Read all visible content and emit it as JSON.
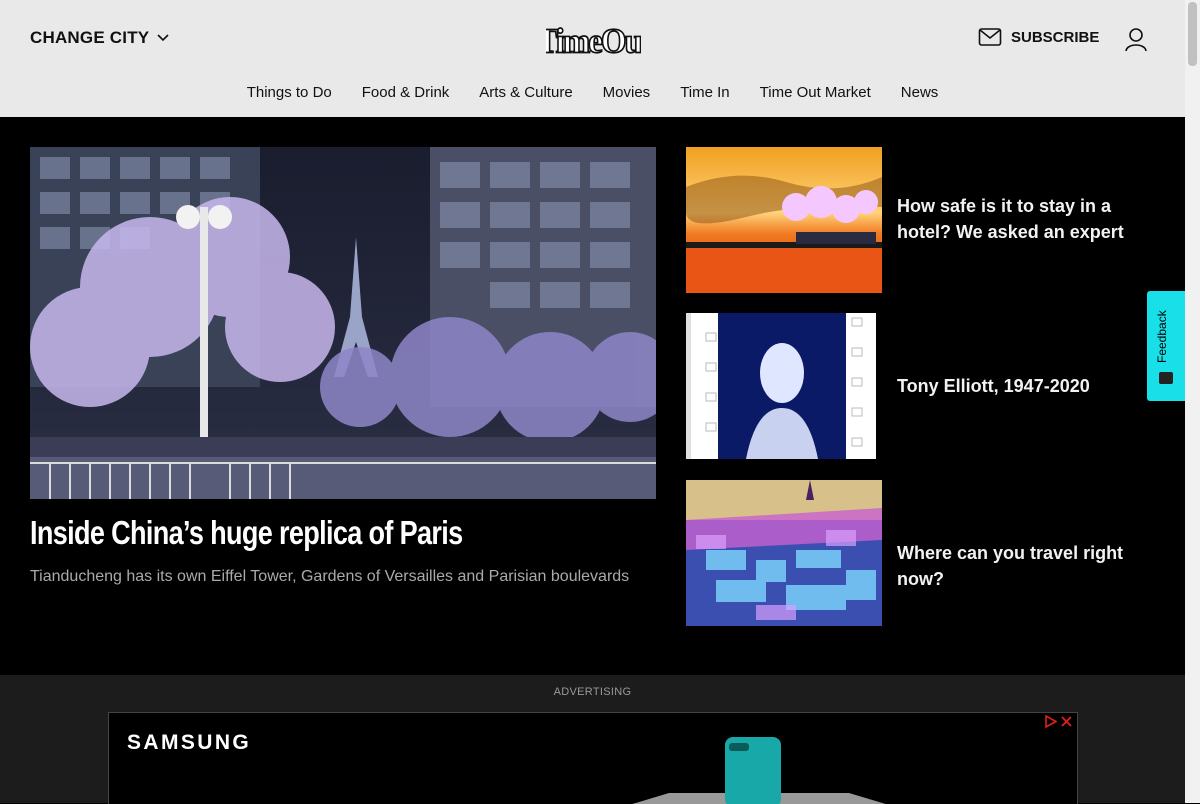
{
  "header": {
    "change_city": "CHANGE CITY",
    "logo_alt": "Time Out",
    "subscribe": "SUBSCRIBE"
  },
  "nav": [
    {
      "label": "Things to Do"
    },
    {
      "label": "Food & Drink"
    },
    {
      "label": "Arts & Culture"
    },
    {
      "label": "Movies"
    },
    {
      "label": "Time In"
    },
    {
      "label": "Time Out Market"
    },
    {
      "label": "News"
    }
  ],
  "hero": {
    "title": "Inside China’s huge replica of Paris",
    "subtitle": "Tianducheng has its own Eiffel Tower, Gardens of Versailles and Parisian boulevards"
  },
  "side_articles": [
    {
      "title": "How safe is it to stay in a hotel? We asked an expert"
    },
    {
      "title": "Tony Elliott, 1947-2020"
    },
    {
      "title": "Where can you travel right now?"
    }
  ],
  "feedback": {
    "label": "Feedback"
  },
  "ad": {
    "label": "ADVERTISING",
    "brand": "SAMSUNG"
  },
  "colors": {
    "header_bg": "#e9e9e9",
    "page_bg": "#000000",
    "feedback_bg": "#19e0e8",
    "ad_band_bg": "#1c1c1c"
  },
  "icons": [
    "chevron-down-icon",
    "mail-icon",
    "user-icon",
    "adchoices-icon",
    "close-icon",
    "feedback-icon"
  ]
}
